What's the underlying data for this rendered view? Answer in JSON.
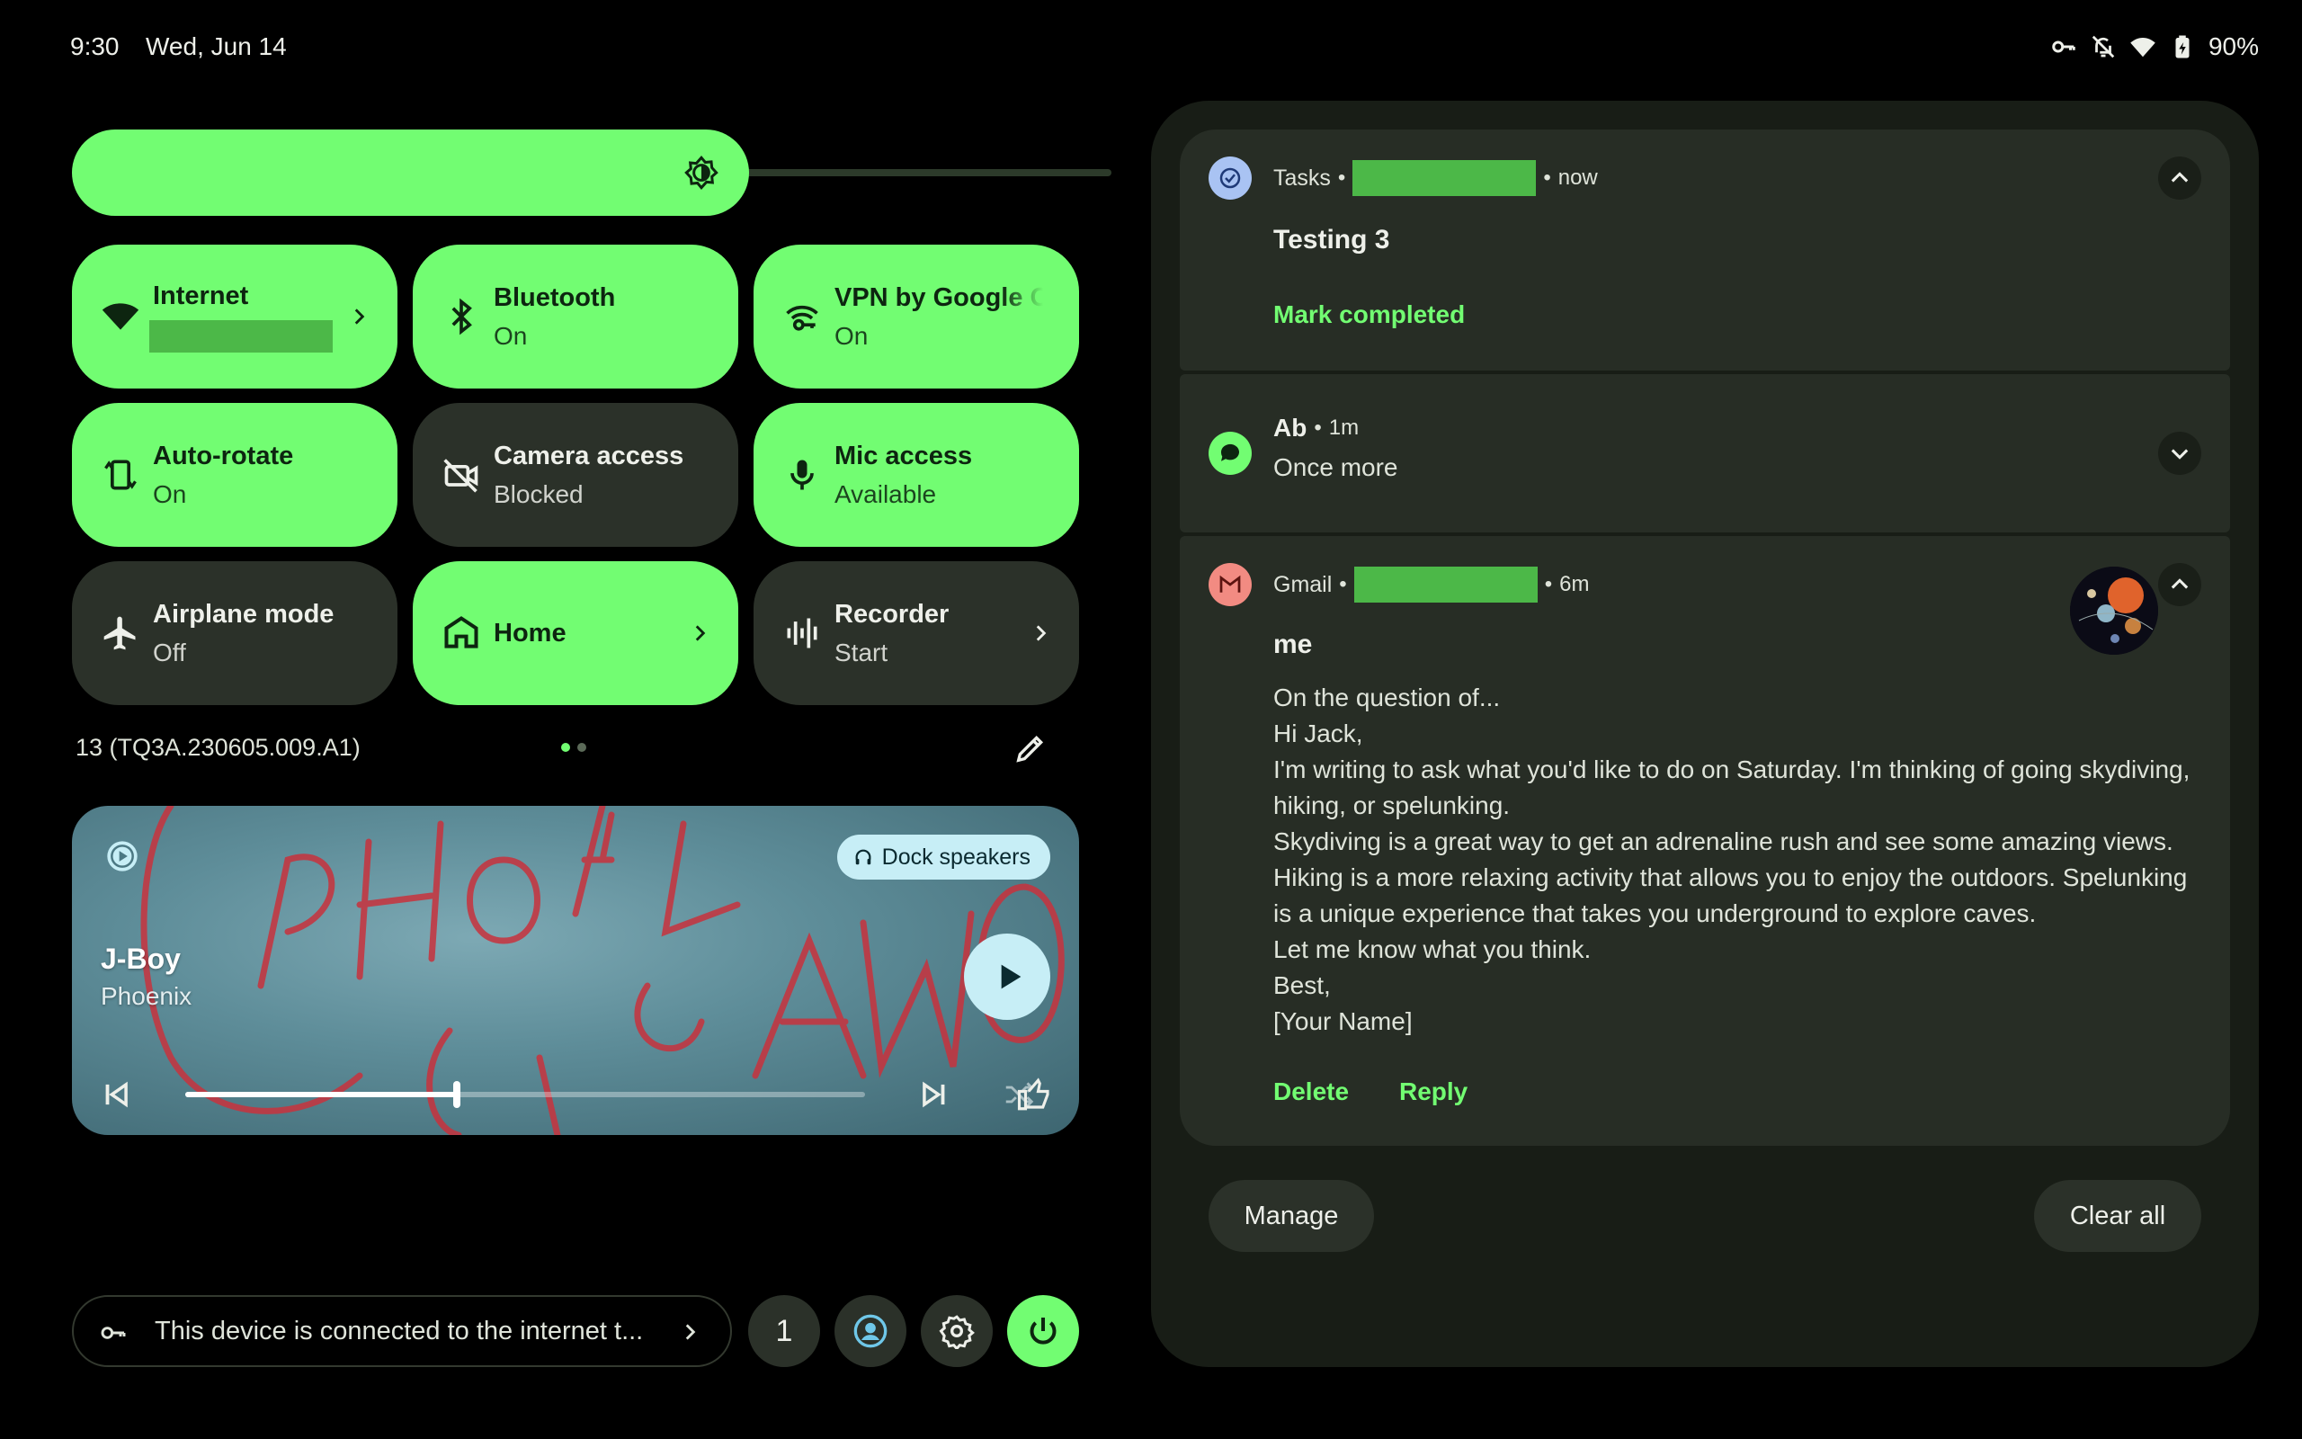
{
  "status_bar": {
    "time": "9:30",
    "date": "Wed, Jun 14",
    "battery": "90%",
    "icons": [
      "vpn-key-icon",
      "silent-bell-icon",
      "wifi-icon",
      "battery-charging-icon"
    ]
  },
  "brightness": {
    "level": 0.7
  },
  "tiles": [
    {
      "title": "Internet",
      "subtitle": "",
      "state": "on",
      "icon": "wifi-icon",
      "chevron": true
    },
    {
      "title": "Bluetooth",
      "subtitle": "On",
      "state": "on",
      "icon": "bluetooth-icon",
      "chevron": false
    },
    {
      "title": "VPN by Google One",
      "subtitle": "On",
      "state": "on",
      "icon": "vpn-icon",
      "chevron": false
    },
    {
      "title": "Auto-rotate",
      "subtitle": "On",
      "state": "on",
      "icon": "rotate-icon",
      "chevron": false
    },
    {
      "title": "Camera access",
      "subtitle": "Blocked",
      "state": "off",
      "icon": "camera-off-icon",
      "chevron": false
    },
    {
      "title": "Mic access",
      "subtitle": "Available",
      "state": "on",
      "icon": "mic-icon",
      "chevron": false
    },
    {
      "title": "Airplane mode",
      "subtitle": "Off",
      "state": "off",
      "icon": "airplane-icon",
      "chevron": false
    },
    {
      "title": "Home",
      "subtitle": "",
      "state": "on",
      "icon": "home-icon",
      "chevron": true
    },
    {
      "title": "Recorder",
      "subtitle": "Start",
      "state": "off",
      "icon": "recorder-icon",
      "chevron": true
    }
  ],
  "build_number": "13 (TQ3A.230605.009.A1)",
  "pager": {
    "pages": 2,
    "current": 1
  },
  "media": {
    "song": "J-Boy",
    "artist": "Phoenix",
    "output_device": "Dock speakers",
    "progress": 0.4
  },
  "security_footer": {
    "text": "This device is connected to the internet t..."
  },
  "user_count": "1",
  "notifications": [
    {
      "app": "Tasks",
      "time": "now",
      "title": "Testing 3",
      "actions": [
        "Mark completed"
      ],
      "expanded": true
    },
    {
      "app": "Ab",
      "time": "1m",
      "text": "Once more",
      "expanded": false
    },
    {
      "app": "Gmail",
      "time": "6m",
      "title": "me",
      "body": [
        "On the question of...",
        "Hi Jack,",
        "I'm writing to ask what you'd like to do on Saturday. I'm thinking of going skydiving, hiking, or spelunking.",
        "Skydiving is a great way to get an adrenaline rush and see some amazing views. Hiking is a more relaxing activity that allows you to enjoy the outdoors. Spelunking is a unique experience that takes you underground to explore caves.",
        "Let me know what you think.",
        "Best,",
        "[Your Name]"
      ],
      "actions": [
        "Delete",
        "Reply"
      ],
      "expanded": true
    }
  ],
  "shade_buttons": {
    "manage": "Manage",
    "clear_all": "Clear all"
  },
  "colors": {
    "accent": "#72fd72",
    "tile_off": "#2b3129",
    "shade_bg": "#181d16",
    "card_bg": "#272d25",
    "redaction": "#4cb848"
  }
}
